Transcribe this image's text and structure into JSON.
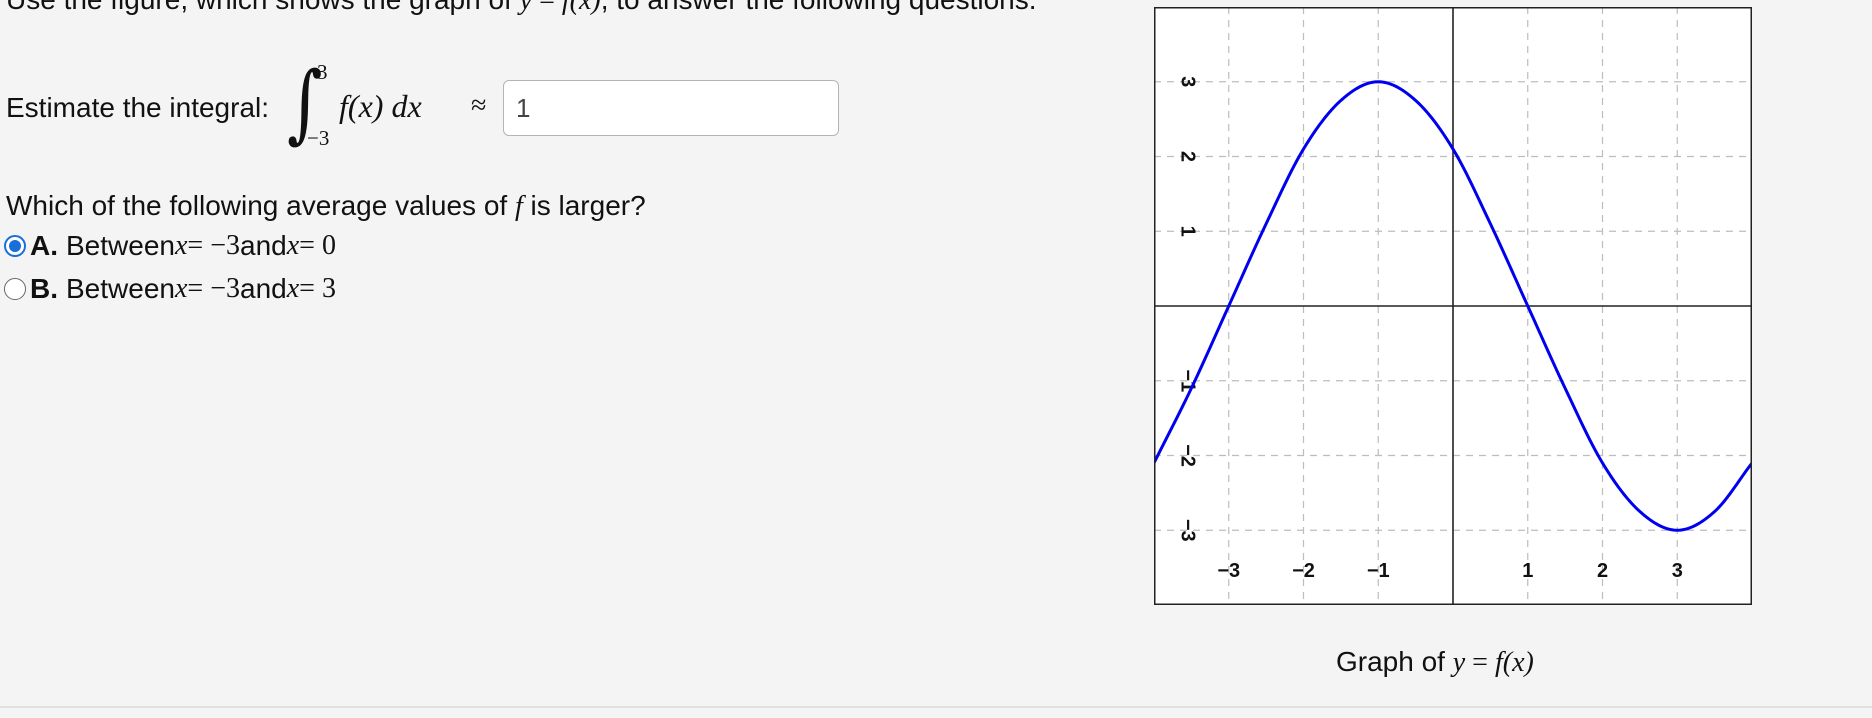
{
  "intro": {
    "before": "Use the figure, which shows the graph of ",
    "y": "y",
    "eq": " = ",
    "f": "f",
    "arg": "(x)",
    "after": ", to answer the following questions."
  },
  "integral": {
    "label": "Estimate the integral:",
    "sign": "∫",
    "upper": "3",
    "lower": "−3",
    "integrand": "f(x) dx",
    "approx": "≈",
    "input_value": "1"
  },
  "question": {
    "before": "Which of the following average values of ",
    "f": "f",
    "after": " is larger?"
  },
  "options": [
    {
      "letter": "A.",
      "text": "Between ",
      "x1": "x",
      "eq1": " = −3",
      "and": " and ",
      "x2": "x",
      "eq2": " = 0",
      "selected": true
    },
    {
      "letter": "B.",
      "text": "Between ",
      "x1": "x",
      "eq1": " = −3",
      "and": " and ",
      "x2": "x",
      "eq2": " = 3",
      "selected": false
    }
  ],
  "graph": {
    "caption_before": "Graph of ",
    "caption_y": "y",
    "caption_eq": " = ",
    "caption_f": "f",
    "caption_arg": "(x)",
    "curve_color": "#0000ee",
    "x_tick_labels": [
      "−3",
      "−2",
      "−1",
      "1",
      "2",
      "3"
    ],
    "y_tick_labels": [
      "3",
      "2",
      "1",
      "−1",
      "−2",
      "−3"
    ]
  },
  "chart_data": {
    "type": "line",
    "xlim": [
      -4,
      4
    ],
    "ylim": [
      -4,
      4
    ],
    "grid": true,
    "x_ticks": [
      -3,
      -2,
      -1,
      1,
      2,
      3
    ],
    "y_ticks": [
      3,
      2,
      1,
      -1,
      -2,
      -3
    ],
    "series": [
      {
        "x": [
          -4,
          -3.5,
          -3,
          -2.5,
          -2,
          -1.5,
          -1,
          -0.5,
          0,
          0.5,
          1,
          1.5,
          2,
          2.5,
          3,
          3.5,
          4
        ],
        "y": [
          -2.1,
          -1.1,
          0,
          1.1,
          2.1,
          2.75,
          3,
          2.75,
          2.1,
          1.1,
          0,
          -1.1,
          -2.1,
          -2.75,
          -3,
          -2.75,
          -2.1
        ]
      }
    ]
  }
}
